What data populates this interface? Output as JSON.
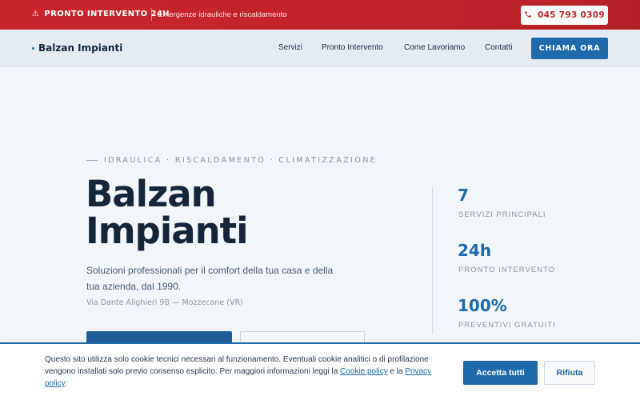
{
  "topbar": {
    "alert_icon": "warning-icon",
    "alert_label": "PRONTO INTERVENTO 24H",
    "subtitle": "Emergenze idrauliche e riscaldamento",
    "phone_icon": "phone-icon",
    "phone": "045 793 0309",
    "color": "#c8252b"
  },
  "nav": {
    "brand": "Balzan Impianti",
    "links": [
      "Servizi",
      "Pronto Intervento",
      "Come Lavoriamo",
      "Contatti"
    ],
    "cta": "CHIAMA ORA",
    "accent": "#1e6aaa"
  },
  "hero": {
    "eyebrow": "IDRAULICA · RISCALDAMENTO · CLIMATIZZAZIONE",
    "title_line1": "Balzan",
    "title_line2": "Impianti",
    "lead_line1": "Soluzioni professionali per il comfort della tua casa e della",
    "lead_line2": "tua azienda, dal 1990.",
    "address": "Via Dante Alighieri 9B — Mozzecane (VR)"
  },
  "stats": [
    {
      "value": "7",
      "label": "SERVIZI PRINCIPALI"
    },
    {
      "value": "24h",
      "label": "PRONTO INTERVENTO"
    },
    {
      "value": "100%",
      "label": "PREVENTIVI GRATUITI"
    }
  ],
  "cookie": {
    "text_part1": "Questo sito utilizza solo cookie tecnici necessari al funzionamento. Eventuali cookie analitici o di profilazione vengono installati solo previo consenso esplicito. Per maggiori informazioni leggi la ",
    "cookie_link": "Cookie policy",
    "text_part2": " e la ",
    "privacy_link": "Privacy policy",
    "text_part3": ".",
    "accept": "Accetta tutti",
    "reject": "Rifiuta"
  }
}
